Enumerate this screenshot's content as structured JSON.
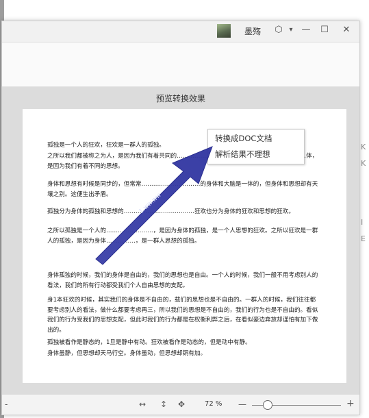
{
  "titlebar": {
    "username": "墨殇",
    "icons": [
      "avatar-image",
      "badge-icon",
      "dropdown-icon",
      "minimize-icon",
      "maximize-icon",
      "close-icon"
    ],
    "glyphs": {
      "badge": "⬡",
      "dropdown": "▾",
      "minimize": "—",
      "maximize": "☐",
      "close": "✕"
    }
  },
  "preview": {
    "title": "预览转换效果",
    "paragraphs": [
      "孤独是一个人的狂欢，狂欢是一群人的孤独。",
      "之所以我们都被称之为人，是因为我们有着共同的…………………………………………………………体，是因为我们有着不同的思想。",
      "身体和思想有时候是同步的，但常常…………………………的身体和大脑是一体的，但身体和思想却有天壤之别。这便生出矛盾。",
      "孤独分为身体的孤独和思想的………………………………狂欢也分为身体的狂欢和思想的狂欢。",
      "之所以孤独是一个人的……………………，是因为身体的孤独，是一个人思想的狂欢。之所以狂欢是一群人的孤独，是因为身体……………，是一群人思想的孤独。",
      "身体孤独的时候，我们的身体是自由的，我们的思想也是自由。一个人的时候，我们一般不用考虑别人的看法，我们的所有行动都受我们个人自由思想的支配。",
      "身1本狂欢的时候，其实我们的身体是不自由的，载们的思想也是不自由的。一群人的时候，我们往往都要考虑别人的看法，做什么都要考虑再三，所以我们的思想是不自由的，我们的行为也是不自由的。看似我们的行为受我们的思想支配，但此时我们的行为都是在权衡利弊之后，在看似豪边奔放却谨怕有加下做出的。",
      "孤独被看作是静态的，1旦是静中有动。狂欢被看作是动态的，但是动中有静。",
      "身体虽静，但思想却天马行空。身体虽动，但思想却铜有加。"
    ],
    "watermark": "1.ww.ww"
  },
  "context_menu": {
    "items": [
      "转换成DOC文档",
      "解析结果不理想"
    ]
  },
  "statusbar": {
    "left_glyph": "-",
    "fit_width_icon": "↔",
    "fit_height_icon": "↕",
    "move_icon": "✥",
    "zoom_value": "72 %",
    "zoom_out": "—",
    "zoom_in": "+",
    "zoom_level": 0.17
  },
  "side_glyphs": [
    "K",
    "K",
    "I",
    "E"
  ],
  "colors": {
    "arrow": "#3a3fa8",
    "page_bg": "#dcdcdc"
  }
}
